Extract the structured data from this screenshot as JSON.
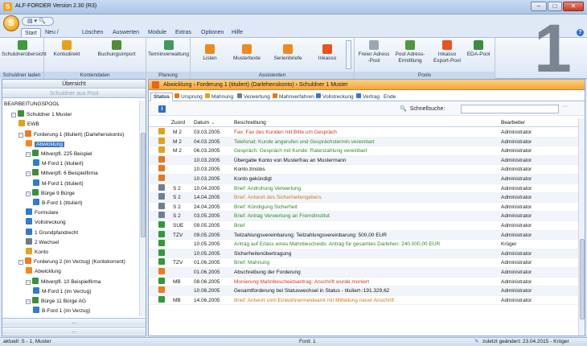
{
  "window": {
    "title": "ALF-FORDER Version 2.30 (R3)"
  },
  "app_button": "S",
  "ribbon_tabs": [
    "Start",
    "Neu / Ändern",
    "Löschen",
    "Auswerten",
    "Module",
    "Extras",
    "Optionen",
    "Hilfe"
  ],
  "ribbon": {
    "groups": [
      {
        "label": "Schuldner laden",
        "buttons": [
          "Schuldnerübersicht"
        ]
      },
      {
        "label": "Kontendaten",
        "buttons": [
          "Kontodirekt",
          "Buchungsimport"
        ]
      },
      {
        "label": "Planung",
        "buttons": [
          "Terminverwaltung"
        ]
      },
      {
        "label": "Assistenten",
        "buttons": [
          "Listen",
          "Mustertexte",
          "Serienbriefe",
          "Inkasso"
        ]
      },
      {
        "label": "Pools",
        "buttons": [
          "Freier Adress -Pool",
          "Pool Adress-Ermittlung",
          "Inkasso Export-Pool",
          "EDA-Pool"
        ]
      }
    ],
    "big_number": "1"
  },
  "left": {
    "overview_button": "Übersicht",
    "pool_button": "Schuldner aus Pool",
    "tree": [
      {
        "label": "BEARBEITUNGSPOOL",
        "depth": 0,
        "icon": "none"
      },
      {
        "label": "Schuldner 1 Muster",
        "depth": 1,
        "icon": "person"
      },
      {
        "label": "EWB",
        "depth": 2,
        "icon": "coins"
      },
      {
        "label": "Forderung 1 (tituliert) (Darlehenskonto)",
        "depth": 2,
        "icon": "flag-orange"
      },
      {
        "label": "Abwicklung",
        "depth": 3,
        "icon": "doc-orange",
        "selected": true
      },
      {
        "label": "Mitverpfl. 225 Beispiel",
        "depth": 3,
        "icon": "person"
      },
      {
        "label": "M-Ford 1 (tituliert)",
        "depth": 4,
        "icon": "flag-blue"
      },
      {
        "label": "Mitverpfl. 6 Beispielfirma",
        "depth": 3,
        "icon": "person"
      },
      {
        "label": "M-Ford 1 (tituliert)",
        "depth": 4,
        "icon": "flag-blue"
      },
      {
        "label": "Bürge 9 Bürge",
        "depth": 3,
        "icon": "person"
      },
      {
        "label": "B-Ford 1 (tituliert)",
        "depth": 4,
        "icon": "flag-blue"
      },
      {
        "label": "Formulare",
        "depth": 3,
        "icon": "doc-blue"
      },
      {
        "label": "Vollstreckung",
        "depth": 3,
        "icon": "doc-blue"
      },
      {
        "label": "1 Grundpfandrecht",
        "depth": 3,
        "icon": "house"
      },
      {
        "label": "2 Wechsel",
        "depth": 3,
        "icon": "paper"
      },
      {
        "label": "Konto",
        "depth": 3,
        "icon": "coins"
      },
      {
        "label": "Forderung 2 (im Verzug) (Kontokorrent)",
        "depth": 2,
        "icon": "flag-orange"
      },
      {
        "label": "Abwicklung",
        "depth": 3,
        "icon": "doc-orange"
      },
      {
        "label": "Mitverpfl. 10 Beispielfirma",
        "depth": 3,
        "icon": "person"
      },
      {
        "label": "M-Ford 1 (im Verzug)",
        "depth": 4,
        "icon": "flag-blue"
      },
      {
        "label": "Bürge 11 Bürge AG",
        "depth": 3,
        "icon": "person"
      },
      {
        "label": "B-Ford 1 (im Verzug)",
        "depth": 4,
        "icon": "flag-blue"
      }
    ],
    "footer1": "...",
    "footer2": "..."
  },
  "breadcrumb": [
    "Abwicklung",
    "Forderung 1 (tituliert) (Darlehenskonto)",
    "Schuldner 1 Muster"
  ],
  "subtabs": [
    "Status",
    "Ursprung",
    "Mahnung",
    "Verwertung",
    "Mahnverfahren",
    "Vollstreckung",
    "Vertrag",
    "Ende"
  ],
  "search": {
    "label": "Schnellsuche:",
    "value": ""
  },
  "grid": {
    "headers": {
      "zuord": "Zuord",
      "datum": "Datum",
      "beschreibung": "Beschreibung",
      "bearbeiter": "Bearbeiter"
    },
    "rows": [
      {
        "icon": "coins",
        "zuord": "M 2",
        "datum": "03.03.2005",
        "text": "Fax: Fax des Kunden mit Bitte um Gespräch",
        "color": "red",
        "bearbeiter": "Administrator"
      },
      {
        "icon": "coins",
        "zuord": "M 2",
        "datum": "04.03.2005",
        "text": "Telefonat: Kunde angerufen und Gesprächstermin vereinbart",
        "color": "green",
        "bearbeiter": "Administrator"
      },
      {
        "icon": "coins",
        "zuord": "M 2",
        "datum": "06.03.2005",
        "text": "Gespräch: Gespräch mit Kunde: Ratenzahlung vereinbart",
        "color": "green",
        "bearbeiter": "Administrator"
      },
      {
        "icon": "arrows",
        "zuord": "",
        "datum": "10.03.2005",
        "text": "Übergabe Konto von Musterfrau an Mustermann",
        "color": "black",
        "bearbeiter": "Administrator"
      },
      {
        "icon": "arrows",
        "zuord": "",
        "datum": "10.03.2005",
        "text": "Konto zinslos",
        "color": "black",
        "bearbeiter": "Administrator"
      },
      {
        "icon": "arrows",
        "zuord": "",
        "datum": "10.03.2005",
        "text": "Konto gekündigt",
        "color": "black",
        "bearbeiter": "Administrator"
      },
      {
        "icon": "scale",
        "zuord": "S 2",
        "datum": "10.04.2005",
        "text": "Brief: Androhung Verwertung",
        "color": "green",
        "bearbeiter": "Administrator"
      },
      {
        "icon": "scale",
        "zuord": "S 2",
        "datum": "14.04.2005",
        "text": "Brief: Antwort des Sicherheitengebers",
        "color": "orange",
        "bearbeiter": "Administrator"
      },
      {
        "icon": "scale",
        "zuord": "S 2",
        "datum": "24.04.2005",
        "text": "Brief: Kündigung Sicherheit",
        "color": "green",
        "bearbeiter": "Administrator"
      },
      {
        "icon": "scale",
        "zuord": "S 2",
        "datum": "03.05.2005",
        "text": "Brief: Antrag Verwertung an Fremdinstitut",
        "color": "green",
        "bearbeiter": "Administrator"
      },
      {
        "icon": "doc-green",
        "zuord": "SUE",
        "datum": "09.05.2005",
        "text": "Brief",
        "color": "green",
        "bearbeiter": "Administrator"
      },
      {
        "icon": "doc-green",
        "zuord": "TZV",
        "datum": "09.05.2005",
        "text": "Teilzahlungsvereinbarung: Teilzahlungsvereinbarung: 500,00 EUR",
        "color": "black",
        "bearbeiter": "Administrator"
      },
      {
        "icon": "doc-green",
        "zuord": "",
        "datum": "10.05.2005",
        "text": "Antrag auf Erlass eines Mahnbescheids: Antrag für gesamtes Darlehen: 240.000,00 EUR",
        "color": "green",
        "bearbeiter": "Krüger"
      },
      {
        "icon": "doc-green",
        "zuord": "",
        "datum": "10.05.2005",
        "text": "Sicherheitenübertragung",
        "color": "black",
        "bearbeiter": "Administrator"
      },
      {
        "icon": "doc-green",
        "zuord": "TZV",
        "datum": "01.06.2005",
        "text": "Brief: Mahnung",
        "color": "green",
        "bearbeiter": "Administrator"
      },
      {
        "icon": "flag-orange",
        "zuord": "",
        "datum": "01.06.2005",
        "text": "Abschreibung der Forderung",
        "color": "black",
        "bearbeiter": "Administrator"
      },
      {
        "icon": "doc-green",
        "zuord": "MB",
        "datum": "08.06.2005",
        "text": "Monierung Mahnbescheidsantrag: Anschrift wurde moniert",
        "color": "red",
        "bearbeiter": "Administrator"
      },
      {
        "icon": "flag-orange",
        "zuord": "",
        "datum": "10.06.2005",
        "text": "Gesamtforderung bei Statuswechsel in Status - tituliert-:191.329,62",
        "color": "black",
        "bearbeiter": "Administrator"
      },
      {
        "icon": "doc-green",
        "zuord": "MB",
        "datum": "14.06.2005",
        "text": "Brief: Antwort vom Einwohnermeldeamt mit Mitteilung neuer Anschrift",
        "color": "orange",
        "bearbeiter": "Administrator"
      }
    ]
  },
  "status": {
    "left": "aktuell: S - 1, Muster",
    "center": "Ford: 1",
    "right": "zuletzt geändert: 23.04.2015 - Krüger"
  },
  "colors": {
    "accent_orange": "#f3a63a",
    "selection_blue": "#3a78cc"
  }
}
